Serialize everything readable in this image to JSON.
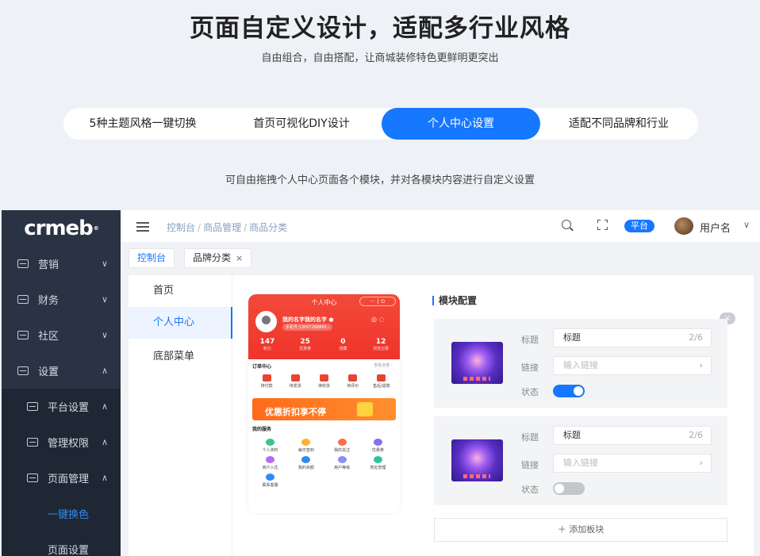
{
  "hero": {
    "title": "页面自定义设计，适配多行业风格",
    "subtitle": "自由组合，自由搭配，让商城装修特色更鲜明更突出"
  },
  "feature_tabs": [
    {
      "label": "5种主题风格一键切换",
      "active": false
    },
    {
      "label": "首页可视化DIY设计",
      "active": false
    },
    {
      "label": "个人中心设置",
      "active": true
    },
    {
      "label": "适配不同品牌和行业",
      "active": false
    }
  ],
  "description": "可自由拖拽个人中心页面各个模块，并对各模块内容进行自定义设置",
  "app": {
    "logo": "crmeb",
    "logo_mark": "®",
    "sidebar": [
      {
        "label": "营销",
        "caret": "∨"
      },
      {
        "label": "财务",
        "caret": "∨"
      },
      {
        "label": "社区",
        "caret": "∨"
      },
      {
        "label": "设置",
        "caret": "∧"
      },
      {
        "label": "平台设置",
        "caret": "∧"
      },
      {
        "label": "管理权限",
        "caret": "∧"
      },
      {
        "label": "页面管理",
        "caret": "∧"
      },
      {
        "label": "一键换色"
      },
      {
        "label": "页面设置"
      }
    ],
    "breadcrumb": [
      "控制台",
      "商品管理",
      "商品分类"
    ],
    "breadcrumb_sep": "/",
    "platform_badge": "平台",
    "username": "用户名",
    "user_caret": "∨",
    "tags": [
      {
        "label": "控制台",
        "active": true
      },
      {
        "label": "品牌分类",
        "close": "×"
      }
    ],
    "submenu": [
      "首页",
      "个人中心",
      "底部菜单"
    ],
    "phone": {
      "title": "个人中心",
      "pill": "··· | ⊙",
      "nickname": "我的名字我的名字 ●",
      "phone": "手机号:13007288865 ›",
      "icons": "◎ ◌",
      "stats": [
        {
          "value": "147",
          "label": "积分"
        },
        {
          "value": "25",
          "label": "优惠券"
        },
        {
          "value": "0",
          "label": "收藏"
        },
        {
          "value": "12",
          "label": "浏览记录"
        }
      ],
      "order_title": "订单中心",
      "order_more": "查看全部 ›",
      "orders": [
        "待付款",
        "待发货",
        "待收货",
        "待评价",
        "售后/退款"
      ],
      "banner": "优惠折扣享不停",
      "service_title": "我的服务",
      "services": [
        {
          "label": "个人资料",
          "color": "#3ec48a"
        },
        {
          "label": "每日签到",
          "color": "#ffb02e"
        },
        {
          "label": "我的关注",
          "color": "#ff6a4a"
        },
        {
          "label": "优惠券",
          "color": "#8a6cf0"
        },
        {
          "label": "商户入住",
          "color": "#b86cf0"
        },
        {
          "label": "我的余额",
          "color": "#2d8cf0"
        },
        {
          "label": "用户等级",
          "color": "#8a8ff0"
        },
        {
          "label": "地址管理",
          "color": "#2ec4a0"
        },
        {
          "label": "联系客服",
          "color": "#2d8cf0"
        }
      ]
    },
    "config": {
      "title": "模块配置",
      "close": "×",
      "cards": [
        {
          "title_label": "标题",
          "title_value": "标题",
          "count": "2/6",
          "link_label": "链接",
          "link_placeholder": "输入链接",
          "link_chevron": "›",
          "status_label": "状态",
          "status_on": true
        },
        {
          "title_label": "标题",
          "title_value": "标题",
          "count": "2/6",
          "link_label": "链接",
          "link_placeholder": "输入链接",
          "link_chevron": "›",
          "status_label": "状态",
          "status_on": false
        }
      ],
      "add_label": "＋ 添加板块"
    },
    "accent": "#1677ff",
    "sidebar_bg": "#2a3343"
  }
}
